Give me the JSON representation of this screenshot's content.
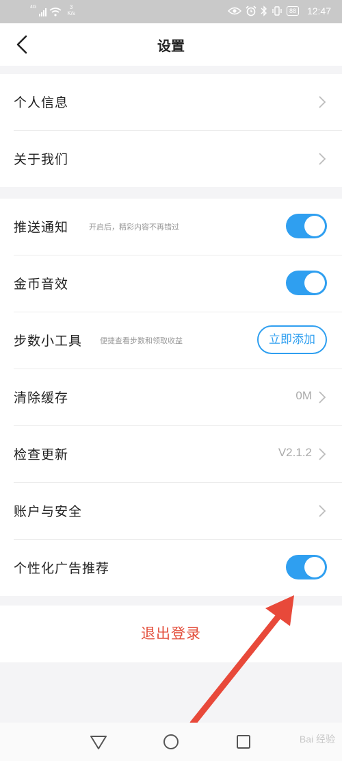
{
  "status_bar": {
    "network": "4G",
    "speed_value": "3",
    "speed_unit": "K/s",
    "battery": "88",
    "time": "12:47",
    "icons": [
      "signal-icon",
      "wifi-icon",
      "eye-icon",
      "alarm-icon",
      "bluetooth-icon",
      "vibrate-icon",
      "battery-icon"
    ]
  },
  "header": {
    "title": "设置"
  },
  "group1": [
    {
      "label": "个人信息"
    },
    {
      "label": "关于我们"
    }
  ],
  "group2": {
    "push": {
      "label": "推送通知",
      "sub": "开启后，精彩内容不再错过",
      "on": true
    },
    "coin_sound": {
      "label": "金币音效",
      "on": true
    },
    "step_tool": {
      "label": "步数小工具",
      "sub": "便捷查看步数和领取收益",
      "button": "立即添加"
    },
    "clear_cache": {
      "label": "清除缓存",
      "value": "0M"
    },
    "check_update": {
      "label": "检查更新",
      "value": "V2.1.2"
    },
    "account": {
      "label": "账户与安全"
    },
    "ads": {
      "label": "个性化广告推荐",
      "on": true
    }
  },
  "logout_label": "退出登录",
  "watermark": "Bai 经验",
  "colors": {
    "accent": "#2f9ff0",
    "logout": "#e34d3a",
    "arrow": "#e8493a"
  }
}
